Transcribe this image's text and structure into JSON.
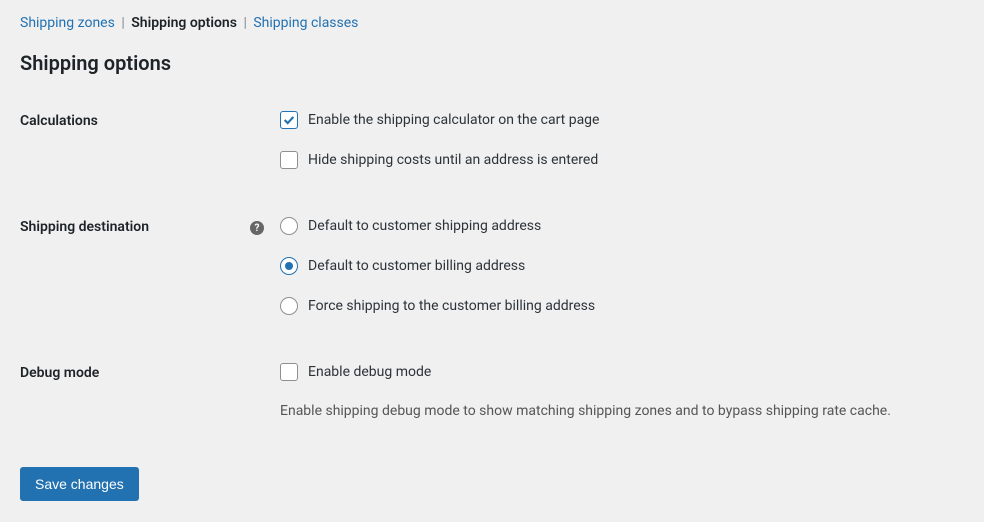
{
  "tabs": {
    "shipping_zones": "Shipping zones",
    "shipping_options": "Shipping options",
    "shipping_classes": "Shipping classes"
  },
  "heading": "Shipping options",
  "sections": {
    "calculations": {
      "label": "Calculations",
      "enable_calculator": "Enable the shipping calculator on the cart page",
      "hide_costs": "Hide shipping costs until an address is entered"
    },
    "destination": {
      "label": "Shipping destination",
      "help": "?",
      "opt_shipping": "Default to customer shipping address",
      "opt_billing": "Default to customer billing address",
      "opt_force": "Force shipping to the customer billing address"
    },
    "debug": {
      "label": "Debug mode",
      "enable_debug": "Enable debug mode",
      "description": "Enable shipping debug mode to show matching shipping zones and to bypass shipping rate cache."
    }
  },
  "save_button": "Save changes"
}
